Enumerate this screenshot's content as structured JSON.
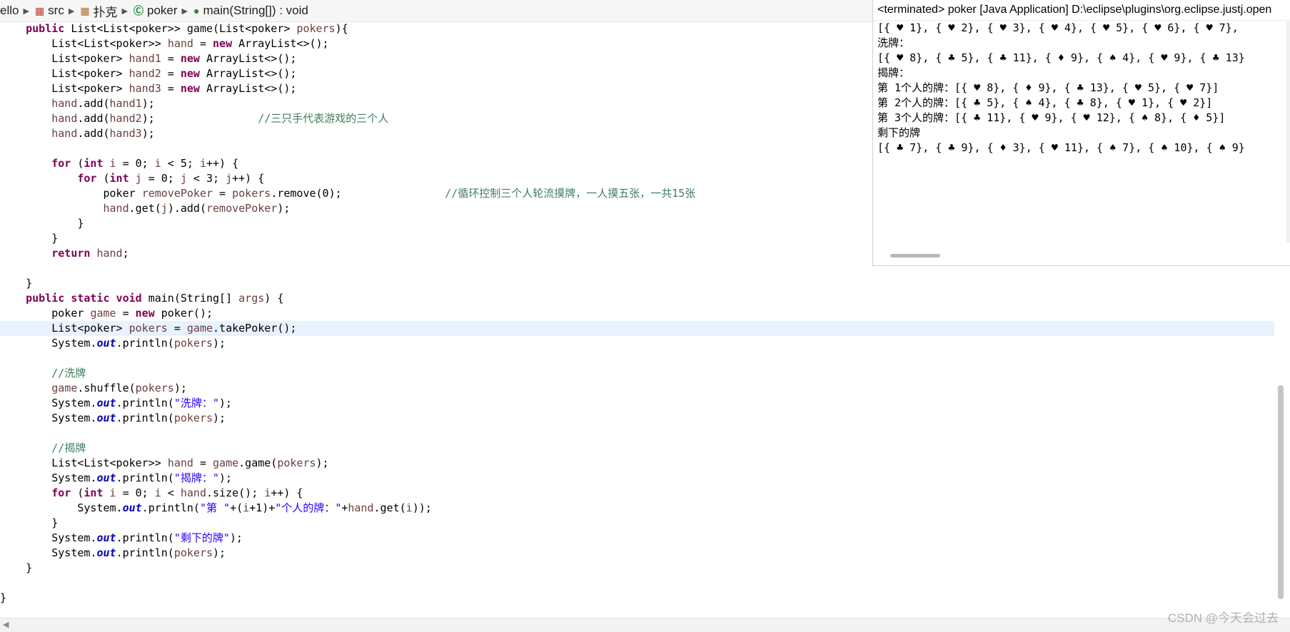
{
  "breadcrumb": {
    "items": [
      "ello",
      "src",
      "扑克",
      "poker",
      "main(String[]) : void"
    ]
  },
  "console": {
    "title": "<terminated> poker [Java Application] D:\\eclipse\\plugins\\org.eclipse.justj.open",
    "lines": [
      "[{ ♥ 1}, { ♥ 2}, { ♥ 3}, { ♥ 4}, { ♥ 5}, { ♥ 6}, { ♥ 7},",
      "洗牌：",
      "[{ ♥ 8}, { ♣ 5}, { ♣ 11}, { ♦ 9}, { ♠ 4}, { ♥ 9}, { ♣ 13}",
      "揭牌：",
      "第 1个人的牌：[{ ♥ 8}, { ♦ 9}, { ♣ 13}, { ♥ 5}, { ♥ 7}]",
      "第 2个人的牌：[{ ♣ 5}, { ♠ 4}, { ♣ 8}, { ♥ 1}, { ♥ 2}]",
      "第 3个人的牌：[{ ♣ 11}, { ♥ 9}, { ♥ 12}, { ♠ 8}, { ♦ 5}]",
      "剩下的牌",
      "[{ ♣ 7}, { ♣ 9}, { ♦ 3}, { ♥ 11}, { ♠ 7}, { ♠ 10}, { ♠ 9}"
    ]
  },
  "code": {
    "lines": [
      [
        [
          "    ",
          "plain"
        ],
        [
          "public",
          "kw"
        ],
        [
          " List<List<poker>> game(List<poker> ",
          "plain"
        ],
        [
          "pokers",
          "var"
        ],
        [
          "){",
          "plain"
        ]
      ],
      [
        [
          "        List<List<poker>> ",
          "plain"
        ],
        [
          "hand",
          "var"
        ],
        [
          " = ",
          "plain"
        ],
        [
          "new",
          "kw"
        ],
        [
          " ArrayList<>();",
          "plain"
        ]
      ],
      [
        [
          "        List<poker> ",
          "plain"
        ],
        [
          "hand1",
          "var"
        ],
        [
          " = ",
          "plain"
        ],
        [
          "new",
          "kw"
        ],
        [
          " ArrayList<>();",
          "plain"
        ]
      ],
      [
        [
          "        List<poker> ",
          "plain"
        ],
        [
          "hand2",
          "var"
        ],
        [
          " = ",
          "plain"
        ],
        [
          "new",
          "kw"
        ],
        [
          " ArrayList<>();",
          "plain"
        ]
      ],
      [
        [
          "        List<poker> ",
          "plain"
        ],
        [
          "hand3",
          "var"
        ],
        [
          " = ",
          "plain"
        ],
        [
          "new",
          "kw"
        ],
        [
          " ArrayList<>();",
          "plain"
        ]
      ],
      [
        [
          "        ",
          "plain"
        ],
        [
          "hand",
          "var"
        ],
        [
          ".add(",
          "plain"
        ],
        [
          "hand1",
          "var"
        ],
        [
          ");",
          "plain"
        ]
      ],
      [
        [
          "        ",
          "plain"
        ],
        [
          "hand",
          "var"
        ],
        [
          ".add(",
          "plain"
        ],
        [
          "hand2",
          "var"
        ],
        [
          ");                ",
          "plain"
        ],
        [
          "//三只手代表游戏的三个人",
          "cmt"
        ]
      ],
      [
        [
          "        ",
          "plain"
        ],
        [
          "hand",
          "var"
        ],
        [
          ".add(",
          "plain"
        ],
        [
          "hand3",
          "var"
        ],
        [
          ");",
          "plain"
        ]
      ],
      [
        [
          "",
          "plain"
        ]
      ],
      [
        [
          "        ",
          "plain"
        ],
        [
          "for",
          "kw"
        ],
        [
          " (",
          "plain"
        ],
        [
          "int",
          "kw"
        ],
        [
          " ",
          "plain"
        ],
        [
          "i",
          "var"
        ],
        [
          " = 0; ",
          "plain"
        ],
        [
          "i",
          "var"
        ],
        [
          " < 5; ",
          "plain"
        ],
        [
          "i",
          "var"
        ],
        [
          "++) {",
          "plain"
        ]
      ],
      [
        [
          "            ",
          "plain"
        ],
        [
          "for",
          "kw"
        ],
        [
          " (",
          "plain"
        ],
        [
          "int",
          "kw"
        ],
        [
          " ",
          "plain"
        ],
        [
          "j",
          "var"
        ],
        [
          " = 0; ",
          "plain"
        ],
        [
          "j",
          "var"
        ],
        [
          " < 3; ",
          "plain"
        ],
        [
          "j",
          "var"
        ],
        [
          "++) {",
          "plain"
        ]
      ],
      [
        [
          "                poker ",
          "plain"
        ],
        [
          "removePoker",
          "var"
        ],
        [
          " = ",
          "plain"
        ],
        [
          "pokers",
          "var"
        ],
        [
          ".remove(0);                ",
          "plain"
        ],
        [
          "//循环控制三个人轮流摸牌，一人摸五张，一共15张",
          "cmt"
        ]
      ],
      [
        [
          "                ",
          "plain"
        ],
        [
          "hand",
          "var"
        ],
        [
          ".get(",
          "plain"
        ],
        [
          "j",
          "var"
        ],
        [
          ").add(",
          "plain"
        ],
        [
          "removePoker",
          "var"
        ],
        [
          ");",
          "plain"
        ]
      ],
      [
        [
          "            }",
          "plain"
        ]
      ],
      [
        [
          "        }",
          "plain"
        ]
      ],
      [
        [
          "        ",
          "plain"
        ],
        [
          "return",
          "kw"
        ],
        [
          " ",
          "plain"
        ],
        [
          "hand",
          "var"
        ],
        [
          ";",
          "plain"
        ]
      ],
      [
        [
          "",
          "plain"
        ]
      ],
      [
        [
          "    }",
          "plain"
        ]
      ],
      [
        [
          "    ",
          "plain"
        ],
        [
          "public",
          "kw"
        ],
        [
          " ",
          "plain"
        ],
        [
          "static",
          "kw"
        ],
        [
          " ",
          "plain"
        ],
        [
          "void",
          "kw"
        ],
        [
          " main(String[] ",
          "plain"
        ],
        [
          "args",
          "var"
        ],
        [
          ") {",
          "plain"
        ]
      ],
      [
        [
          "        poker ",
          "plain"
        ],
        [
          "game",
          "var"
        ],
        [
          " = ",
          "plain"
        ],
        [
          "new",
          "kw"
        ],
        [
          " poker();",
          "plain"
        ]
      ],
      [
        [
          "        List<poker> ",
          "plain"
        ],
        [
          "pokers",
          "var"
        ],
        [
          " = ",
          "plain"
        ],
        [
          "game",
          "var"
        ],
        [
          ".takePoker();",
          "plain"
        ]
      ],
      [
        [
          "        System.",
          "plain"
        ],
        [
          "out",
          "fld"
        ],
        [
          ".println(",
          "plain"
        ],
        [
          "pokers",
          "var"
        ],
        [
          ");",
          "plain"
        ]
      ],
      [
        [
          "",
          "plain"
        ]
      ],
      [
        [
          "        ",
          "plain"
        ],
        [
          "//洗牌",
          "cmt"
        ]
      ],
      [
        [
          "        ",
          "plain"
        ],
        [
          "game",
          "var"
        ],
        [
          ".shuffle(",
          "plain"
        ],
        [
          "pokers",
          "var"
        ],
        [
          ");",
          "plain"
        ]
      ],
      [
        [
          "        System.",
          "plain"
        ],
        [
          "out",
          "fld"
        ],
        [
          ".println(",
          "plain"
        ],
        [
          "\"洗牌：\"",
          "str"
        ],
        [
          ");",
          "plain"
        ]
      ],
      [
        [
          "        System.",
          "plain"
        ],
        [
          "out",
          "fld"
        ],
        [
          ".println(",
          "plain"
        ],
        [
          "pokers",
          "var"
        ],
        [
          ");",
          "plain"
        ]
      ],
      [
        [
          "",
          "plain"
        ]
      ],
      [
        [
          "        ",
          "plain"
        ],
        [
          "//揭牌",
          "cmt"
        ]
      ],
      [
        [
          "        List<List<poker>> ",
          "plain"
        ],
        [
          "hand",
          "var"
        ],
        [
          " = ",
          "plain"
        ],
        [
          "game",
          "var"
        ],
        [
          ".game(",
          "plain"
        ],
        [
          "pokers",
          "var"
        ],
        [
          ");",
          "plain"
        ]
      ],
      [
        [
          "        System.",
          "plain"
        ],
        [
          "out",
          "fld"
        ],
        [
          ".println(",
          "plain"
        ],
        [
          "\"揭牌：\"",
          "str"
        ],
        [
          ");",
          "plain"
        ]
      ],
      [
        [
          "        ",
          "plain"
        ],
        [
          "for",
          "kw"
        ],
        [
          " (",
          "plain"
        ],
        [
          "int",
          "kw"
        ],
        [
          " ",
          "plain"
        ],
        [
          "i",
          "var"
        ],
        [
          " = 0; ",
          "plain"
        ],
        [
          "i",
          "var"
        ],
        [
          " < ",
          "plain"
        ],
        [
          "hand",
          "var"
        ],
        [
          ".size(); ",
          "plain"
        ],
        [
          "i",
          "var"
        ],
        [
          "++) {",
          "plain"
        ]
      ],
      [
        [
          "            System.",
          "plain"
        ],
        [
          "out",
          "fld"
        ],
        [
          ".println(",
          "plain"
        ],
        [
          "\"第 \"",
          "str"
        ],
        [
          "+(",
          "plain"
        ],
        [
          "i",
          "var"
        ],
        [
          "+1)+",
          "plain"
        ],
        [
          "\"个人的牌：\"",
          "str"
        ],
        [
          "+",
          "plain"
        ],
        [
          "hand",
          "var"
        ],
        [
          ".get(",
          "plain"
        ],
        [
          "i",
          "var"
        ],
        [
          "));",
          "plain"
        ]
      ],
      [
        [
          "        }",
          "plain"
        ]
      ],
      [
        [
          "        System.",
          "plain"
        ],
        [
          "out",
          "fld"
        ],
        [
          ".println(",
          "plain"
        ],
        [
          "\"剩下的牌\"",
          "str"
        ],
        [
          ");",
          "plain"
        ]
      ],
      [
        [
          "        System.",
          "plain"
        ],
        [
          "out",
          "fld"
        ],
        [
          ".println(",
          "plain"
        ],
        [
          "pokers",
          "var"
        ],
        [
          ");",
          "plain"
        ]
      ],
      [
        [
          "    }",
          "plain"
        ]
      ],
      [
        [
          "",
          "plain"
        ]
      ],
      [
        [
          "}",
          "plain"
        ]
      ]
    ]
  },
  "watermark": "CSDN @今天会过去"
}
